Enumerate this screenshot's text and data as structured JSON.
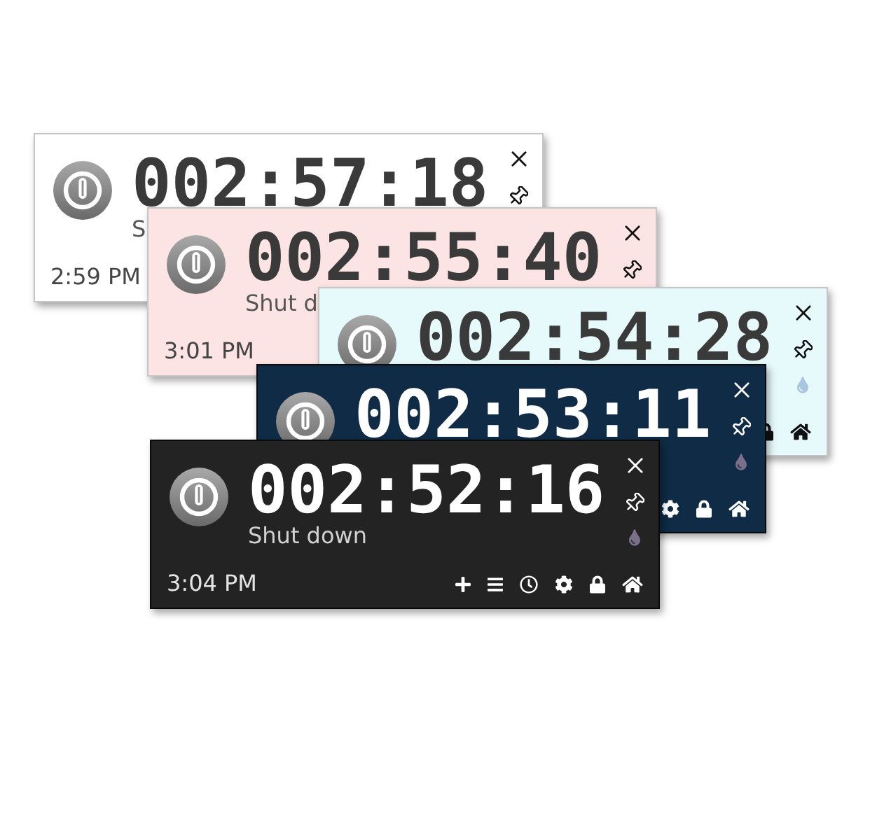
{
  "windows": [
    {
      "color": "#ffffff",
      "countdown": "002:57:18",
      "action": "S",
      "clock": "2:59 PM",
      "side_buttons": [
        {
          "kind": "close"
        },
        {
          "kind": "pin"
        }
      ]
    },
    {
      "color": "#fce4e4",
      "countdown": "002:55:40",
      "action": "Shut d",
      "clock": "3:01 PM",
      "side_buttons": [
        {
          "kind": "close"
        },
        {
          "kind": "pin"
        }
      ]
    },
    {
      "color": "#e6fafc",
      "countdown": "002:54:28",
      "side_buttons": [
        {
          "kind": "close"
        },
        {
          "kind": "pin"
        },
        {
          "kind": "drop"
        }
      ],
      "tools": [
        {
          "kind": "lock"
        },
        {
          "kind": "home"
        }
      ]
    },
    {
      "color": "#0f2b46",
      "countdown": "002:53:11",
      "side_buttons": [
        {
          "kind": "close"
        },
        {
          "kind": "pin"
        },
        {
          "kind": "drop"
        }
      ],
      "tools": [
        {
          "kind": "gear"
        },
        {
          "kind": "lock"
        },
        {
          "kind": "home"
        }
      ]
    },
    {
      "color": "#232323",
      "countdown": "002:52:16",
      "action": "Shut down",
      "clock": "3:04 PM",
      "side_buttons": [
        {
          "kind": "close"
        },
        {
          "kind": "pin"
        },
        {
          "kind": "drop"
        }
      ],
      "tools": [
        {
          "kind": "plus"
        },
        {
          "kind": "list"
        },
        {
          "kind": "clock"
        },
        {
          "kind": "gear"
        },
        {
          "kind": "lock"
        },
        {
          "kind": "home"
        }
      ]
    }
  ]
}
